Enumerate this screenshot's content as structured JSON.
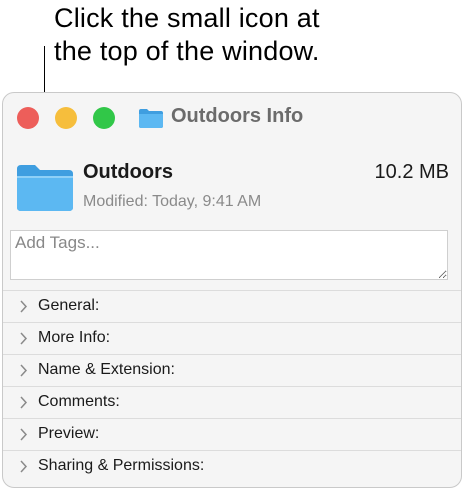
{
  "callout": {
    "line1": "Click the small icon at",
    "line2": "the top of the window."
  },
  "window": {
    "title": "Outdoors Info",
    "traffic_lights": {
      "close_color": "#ed5e5a",
      "minimize_color": "#f6be3c",
      "zoom_color": "#31c748"
    },
    "icons": {
      "title": "folder-icon",
      "header": "folder-icon"
    }
  },
  "header": {
    "name": "Outdoors",
    "size": "10.2 MB",
    "modified": "Modified: Today, 9:41 AM"
  },
  "tags": {
    "placeholder": "Add Tags..."
  },
  "sections": [
    {
      "label": "General:"
    },
    {
      "label": "More Info:"
    },
    {
      "label": "Name & Extension:"
    },
    {
      "label": "Comments:"
    },
    {
      "label": "Preview:"
    },
    {
      "label": "Sharing & Permissions:"
    }
  ],
  "colors": {
    "folder": "#5cb8f2",
    "folder_dark": "#3f9ee0"
  }
}
